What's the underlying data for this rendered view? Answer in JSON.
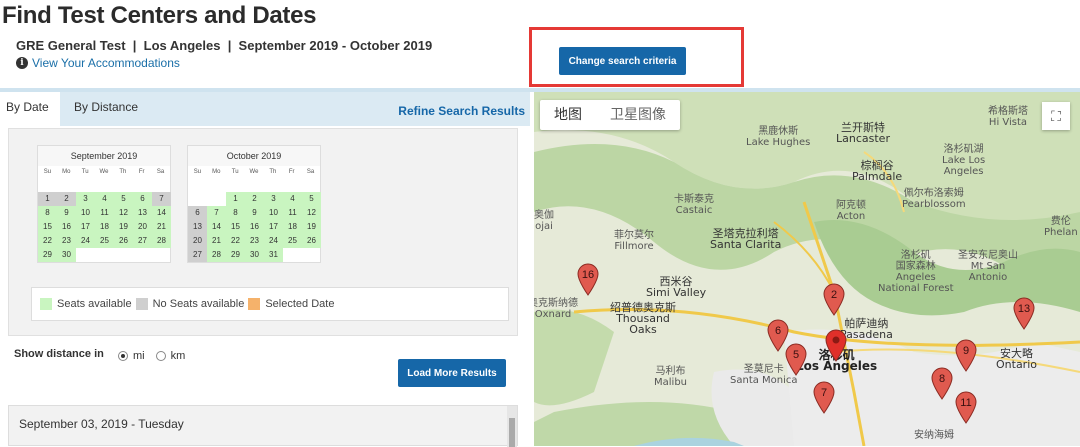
{
  "header": {
    "title": "Find Test Centers and Dates",
    "subtitle": "GRE General Test  |  Los Angeles  |  September 2019 - October 2019",
    "accommodations_link": "View Your Accommodations",
    "info_icon_glyph": "i",
    "change_button": "Change search criteria"
  },
  "tabs": [
    {
      "label": "By Date",
      "active": true
    },
    {
      "label": "By Distance",
      "active": false
    }
  ],
  "refine_link": "Refine Search Results",
  "calendars": [
    {
      "title": "September 2019",
      "dow": [
        "Su",
        "Mo",
        "Tu",
        "We",
        "Th",
        "Fr",
        "Sa"
      ],
      "offset": 0,
      "days": [
        [
          "",
          "",
          "",
          "",
          "",
          "",
          ""
        ],
        [
          "1",
          "n"
        ],
        [
          "2",
          "n"
        ],
        [
          "3",
          "a"
        ],
        [
          "4",
          "a"
        ],
        [
          "5",
          "a"
        ],
        [
          "6",
          "a"
        ],
        [
          "7",
          "n"
        ],
        [
          "8",
          "a"
        ],
        [
          "9",
          "a"
        ],
        [
          "10",
          "a"
        ],
        [
          "11",
          "a"
        ],
        [
          "12",
          "a"
        ],
        [
          "13",
          "a"
        ],
        [
          "14",
          "a"
        ],
        [
          "15",
          "a"
        ],
        [
          "16",
          "a"
        ],
        [
          "17",
          "a"
        ],
        [
          "18",
          "a"
        ],
        [
          "19",
          "a"
        ],
        [
          "20",
          "a"
        ],
        [
          "21",
          "a"
        ],
        [
          "22",
          "a"
        ],
        [
          "23",
          "a"
        ],
        [
          "24",
          "a"
        ],
        [
          "25",
          "a"
        ],
        [
          "26",
          "a"
        ],
        [
          "27",
          "a"
        ],
        [
          "28",
          "a"
        ],
        [
          "29",
          "a"
        ],
        [
          "30",
          "a"
        ]
      ]
    },
    {
      "title": "October 2019",
      "dow": [
        "Su",
        "Mo",
        "Tu",
        "We",
        "Th",
        "Fr",
        "Sa"
      ],
      "offset": 2,
      "days": [
        [
          "1",
          "a"
        ],
        [
          "2",
          "a"
        ],
        [
          "3",
          "a"
        ],
        [
          "4",
          "a"
        ],
        [
          "5",
          "a"
        ],
        [
          "6",
          "n"
        ],
        [
          "7",
          "a"
        ],
        [
          "8",
          "a"
        ],
        [
          "9",
          "a"
        ],
        [
          "10",
          "a"
        ],
        [
          "11",
          "a"
        ],
        [
          "12",
          "a"
        ],
        [
          "13",
          "n"
        ],
        [
          "14",
          "a"
        ],
        [
          "15",
          "a"
        ],
        [
          "16",
          "a"
        ],
        [
          "17",
          "a"
        ],
        [
          "18",
          "a"
        ],
        [
          "19",
          "a"
        ],
        [
          "20",
          "n"
        ],
        [
          "21",
          "a"
        ],
        [
          "22",
          "a"
        ],
        [
          "23",
          "a"
        ],
        [
          "24",
          "a"
        ],
        [
          "25",
          "a"
        ],
        [
          "26",
          "a"
        ],
        [
          "27",
          "n"
        ],
        [
          "28",
          "a"
        ],
        [
          "29",
          "a"
        ],
        [
          "30",
          "a"
        ],
        [
          "31",
          "a"
        ]
      ]
    }
  ],
  "legend": {
    "available": "Seats available",
    "none": "No Seats available",
    "selected": "Selected Date",
    "colors": {
      "available": "#c9f5c0",
      "none": "#cfcfcf",
      "selected": "#f5b26b"
    }
  },
  "distance": {
    "label": "Show distance in",
    "options": [
      {
        "label": "mi",
        "selected": true
      },
      {
        "label": "km",
        "selected": false
      }
    ]
  },
  "load_more": "Load More Results",
  "results": [
    {
      "date": "September 03, 2019 - Tuesday"
    }
  ],
  "map": {
    "tab_map": "地图",
    "tab_satellite": "卫星图像",
    "fullscreen_glyph": "⛶",
    "labels": [
      "黑鹿休斯\nLake Hughes",
      "兰开斯特\nLancaster",
      "希格斯塔\nHi Vista",
      "棕榈谷\nPalmdale",
      "洛杉矶湖\nLake Los\nAngeles",
      "佩尔布洛索姆\nPearblossom",
      "卡斯泰克\nCastaic",
      "阿克顿\nActon",
      "费伦\nPhelan",
      "菲尔莫尔\nFillmore",
      "圣塔克拉利塔\nSanta Clarita",
      "洛杉矶\n国家森林\nAngeles\nNational Forest",
      "圣安东尼奥山\nMt San\nAntonio",
      "西米谷\nSimi Valley",
      "奥克斯纳德\nOxnard",
      "绍普德奥克斯\nThousand\nOaks",
      "帕萨迪纳\nPasadena",
      "洛杉矶\nLos Angeles",
      "圣莫尼卡\nSanta Monica",
      "马利布\nMalibu",
      "安大略\nOntario",
      "安纳海姆",
      "奥伽\nojai"
    ],
    "pins": [
      "16",
      "2",
      "6",
      "5",
      "7",
      "13",
      "9",
      "8",
      "11",
      ""
    ]
  }
}
